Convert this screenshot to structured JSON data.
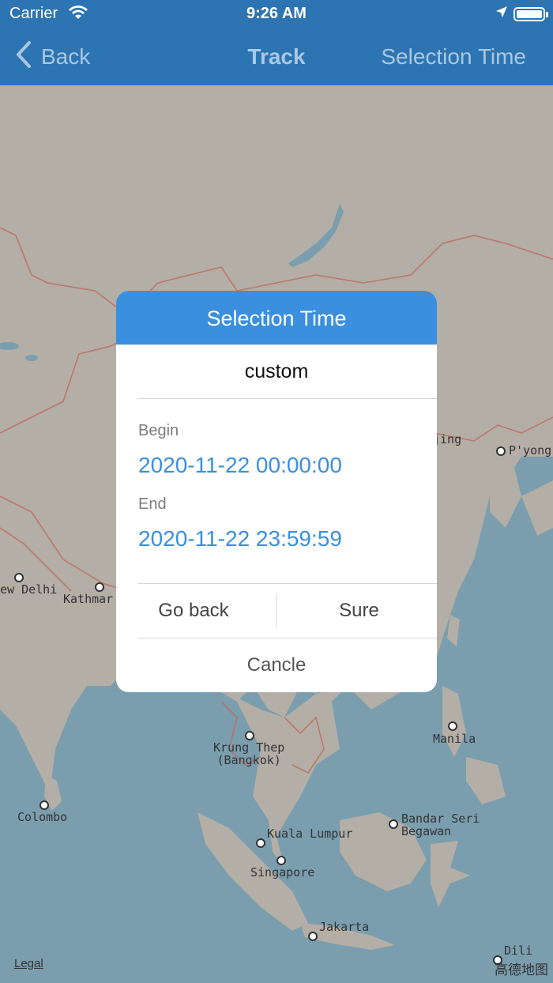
{
  "status_bar": {
    "carrier": "Carrier",
    "time": "9:26 AM"
  },
  "nav": {
    "back_label": "Back",
    "title": "Track",
    "right_label": "Selection Time"
  },
  "map": {
    "cities": [
      {
        "label": "jing"
      },
      {
        "label": "P'yong"
      },
      {
        "label": "ew Delhi"
      },
      {
        "label": "Kathmar"
      },
      {
        "label": "Krung Thep\n(Bangkok)"
      },
      {
        "label": "Manila"
      },
      {
        "label": "Colombo"
      },
      {
        "label": "Bandar Seri\nBegawan"
      },
      {
        "label": "Kuala Lumpur"
      },
      {
        "label": "Singapore"
      },
      {
        "label": "Jakarta"
      },
      {
        "label": "Dili"
      }
    ],
    "legal": "Legal",
    "watermark": "高德地图"
  },
  "dialog": {
    "title": "Selection Time",
    "mode": "custom",
    "begin_label": "Begin",
    "begin_value": "2020-11-22 00:00:00",
    "end_label": "End",
    "end_value": "2020-11-22 23:59:59",
    "go_back_label": "Go back",
    "sure_label": "Sure",
    "cancel_label": "Cancle"
  },
  "colors": {
    "nav_bar": "#2d74b2",
    "dialog_header": "#3a8fde",
    "value_text": "#3a8fde",
    "map_land": "#b3aea6",
    "map_water": "#7a9eae"
  }
}
